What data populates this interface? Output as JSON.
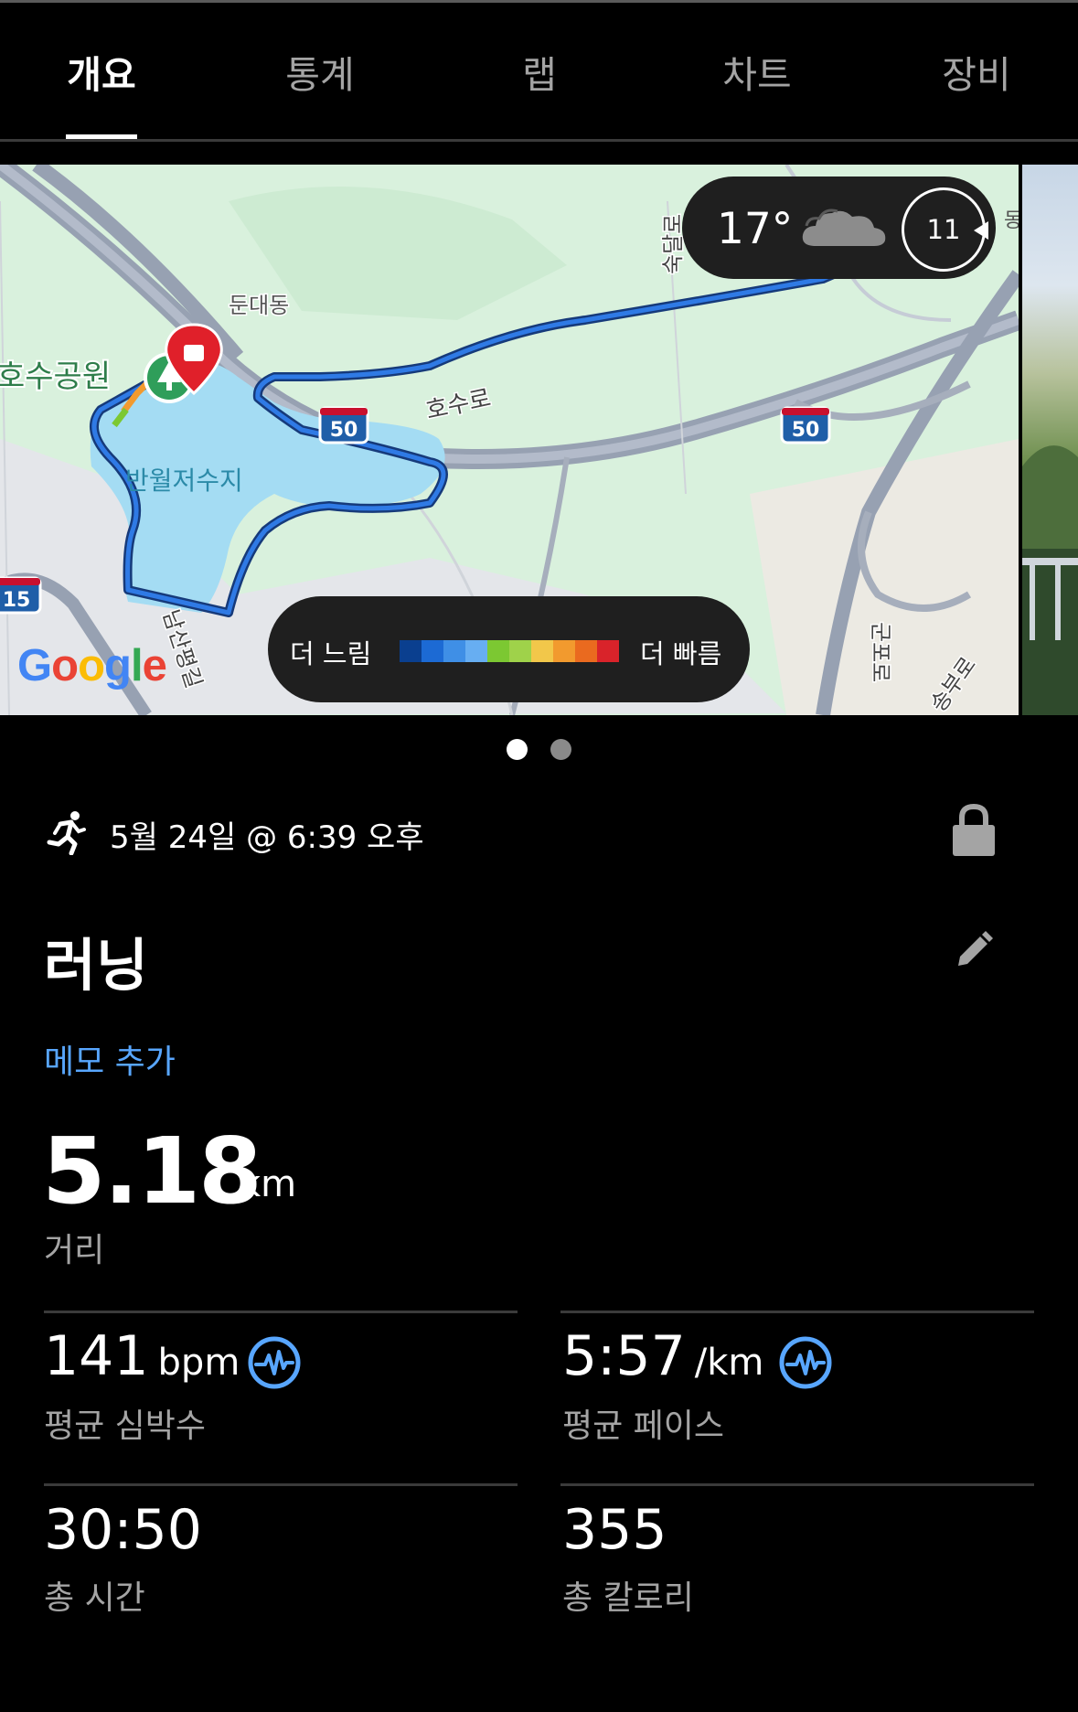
{
  "tabs": [
    {
      "label": "개요",
      "active": true
    },
    {
      "label": "통계",
      "active": false
    },
    {
      "label": "랩",
      "active": false
    },
    {
      "label": "차트",
      "active": false
    },
    {
      "label": "장비",
      "active": false
    }
  ],
  "map": {
    "place_labels": {
      "park": "호수공원",
      "district": "둔대동",
      "reservoir": "반월저수지",
      "road_hosu": "호수로",
      "road_namsan": "남산평길",
      "road_sukdal": "숙달로",
      "road_gunpo": "군포로",
      "road_songbu": "송부로",
      "edge_dong": "동"
    },
    "route_shields": [
      "50",
      "50",
      "15"
    ],
    "attribution": "Google",
    "route_color": "#1e6fe0"
  },
  "weather": {
    "temperature": "17°",
    "icon": "cloud-icon",
    "wind_speed": "11"
  },
  "pace_legend": {
    "slow_label": "더 느림",
    "fast_label": "더 빠름",
    "colors": [
      "#0a3f8f",
      "#1c6ad4",
      "#3f8fe6",
      "#67aef2",
      "#7cc832",
      "#9fd24a",
      "#f2c74a",
      "#f29a2e",
      "#ea6a1f",
      "#d9232a"
    ]
  },
  "pager": {
    "count": 2,
    "active_index": 0
  },
  "activity": {
    "icon": "runner-icon",
    "datetime": "5월 24일 @ 6:39 오후",
    "privacy_icon": "lock-icon",
    "title": "러닝",
    "memo_link": "메모 추가",
    "accent": "#58a6ff"
  },
  "distance": {
    "value": "5.18",
    "unit": "km",
    "label": "거리"
  },
  "stats": [
    {
      "value": "141",
      "unit": "bpm",
      "label": "평균 심박수",
      "icon": "heart-rate-icon"
    },
    {
      "value": "5:57",
      "unit": "/km",
      "label": "평균 페이스",
      "icon": "pace-chart-icon"
    },
    {
      "value": "30:50",
      "unit": "",
      "label": "총 시간"
    },
    {
      "value": "355",
      "unit": "",
      "label": "총 칼로리"
    }
  ]
}
